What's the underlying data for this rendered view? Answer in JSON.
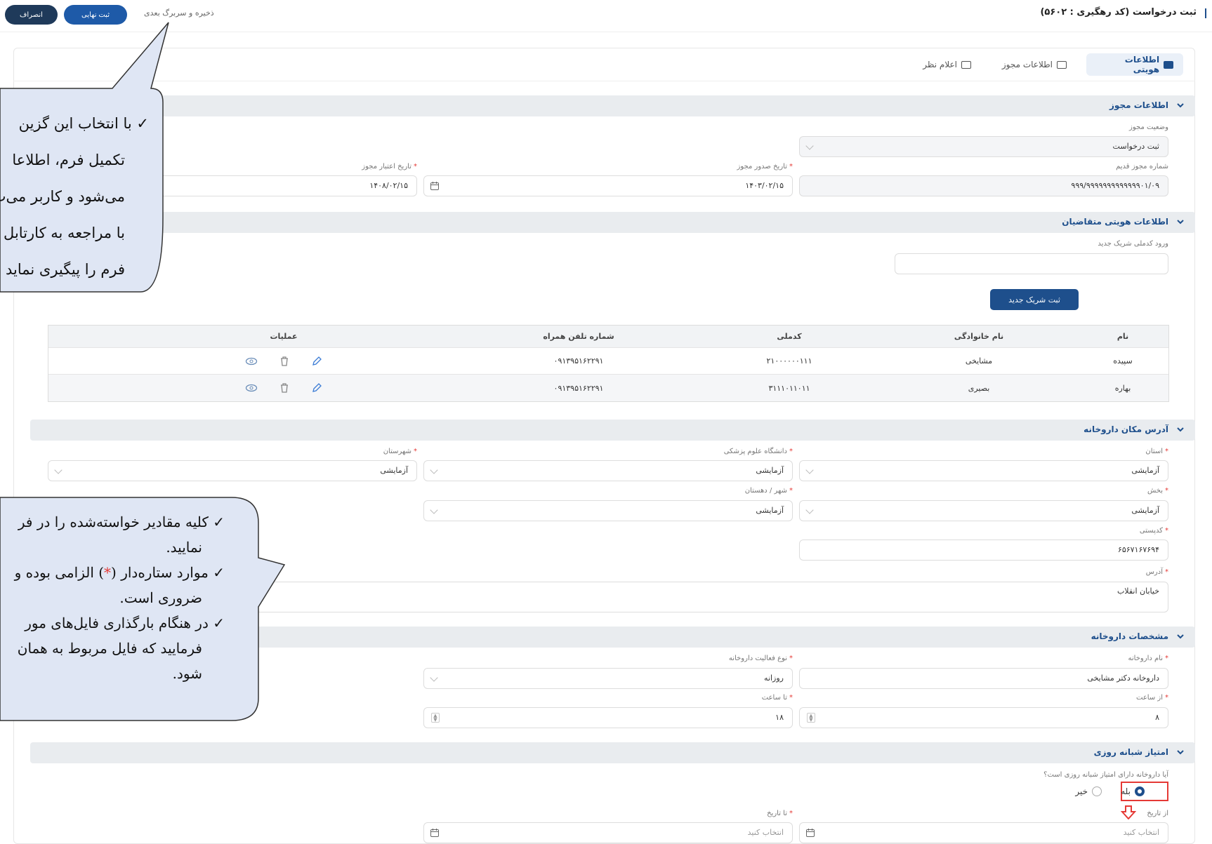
{
  "header": {
    "title": "ثبت درخواست (کد رهگیری : ۵۶۰۲)",
    "cancel_label": "انصراف",
    "final_label": "ثبت نهایی",
    "save_next_label": "ذخیره و سربرگ بعدی"
  },
  "tabs": [
    {
      "label": "اطلاعات هویتی"
    },
    {
      "label": "اطلاعات مجوز"
    },
    {
      "label": "اعلام نظر"
    }
  ],
  "sections": {
    "license": {
      "title": "اطلاعات مجوز",
      "status_label": "وضعیت مجوز",
      "status_value": "ثبت درخواست",
      "old_number_label": "شماره مجوز قدیم",
      "old_number_value": "۹۹۹/۹۹۹۹۹۹۹۹۹۹۹۹۹۰۱/۰۹",
      "issue_date_label": "تاریخ صدور مجوز",
      "issue_date_value": "۱۴۰۳/۰۲/۱۵",
      "expiry_date_label": "تاریخ اعتبار مجوز",
      "expiry_date_value": "۱۴۰۸/۰۲/۱۵"
    },
    "applicants": {
      "title": "اطلاعات هویتی متقاضیان",
      "partner_id_label": "ورود کدملی شریک جدید",
      "add_partner_label": "ثبت شریک جدید",
      "columns": [
        "نام",
        "نام خانوادگی",
        "کدملی",
        "شماره تلفن همراه",
        "عملیات"
      ],
      "rows": [
        [
          "سپیده",
          "مشایخی",
          "۲۱۰۰۰۰۰۰۱۱۱",
          "۰۹۱۳۹۵۱۶۲۲۹۱"
        ],
        [
          "بهاره",
          "بصیری",
          "۳۱۱۱۰۱۱۰۱۱",
          "۰۹۱۳۹۵۱۶۲۲۹۱"
        ]
      ]
    },
    "address": {
      "title": "آدرس مکان داروخانه",
      "province_label": "استان",
      "province_value": "آزمایشی",
      "university_label": "دانشگاه علوم پزشکی",
      "university_value": "آزمایشی",
      "county_label": "شهرستان",
      "county_value": "آزمایشی",
      "district_label": "بخش",
      "district_value": "آزمایشی",
      "city_label": "شهر / دهستان",
      "city_value": "آزمایشی",
      "postal_label": "کدپستی",
      "postal_value": "۶۵۶۷۱۶۷۶۹۴",
      "address_label": "آدرس",
      "address_value": "خیابان انقلاب"
    },
    "pharmacy": {
      "title": "مشخصات داروخانه",
      "name_label": "نام داروخانه",
      "name_value": "داروخانه دکتر مشایخی",
      "type_label": "نوع فعالیت داروخانه",
      "type_value": "روزانه",
      "from_label": "از ساعت",
      "from_value": "۸",
      "to_label": "تا ساعت",
      "to_value": "۱۸"
    },
    "night": {
      "title": "امتیاز شبانه روزی",
      "question": "آیا داروخانه دارای امتیاز شبانه روزی است؟",
      "yes_label": "بله",
      "no_label": "خیر",
      "from_date_label": "از تاریخ",
      "to_date_label": "تا تاریخ",
      "date_placeholder": "انتخاب کنید"
    }
  },
  "callouts": {
    "top": [
      "با انتخاب این گزین",
      "تکمیل فرم، اطلاعا",
      "می‌شود و کاربر می‌ت",
      "با مراجعه به کارتابل",
      "فرم را پیگیری نماید"
    ],
    "bottom": [
      "کلیه مقادیر خواسته‌شده را در فر",
      "نمایید.",
      "موارد ستاره‌دار (",
      ") الزامی بوده و",
      "ضروری است.",
      "در هنگام بارگذاری فایل‌های مور",
      "فرمایید که فایل مربوط به همان",
      "شود."
    ],
    "bottom_mark": "*",
    "check": "✓"
  },
  "colors": {
    "primary": "#1e4f8c",
    "dark": "#1f3a5a",
    "required": "#e53935",
    "highlight": "#e53935",
    "callout": "#dfe6f4"
  }
}
